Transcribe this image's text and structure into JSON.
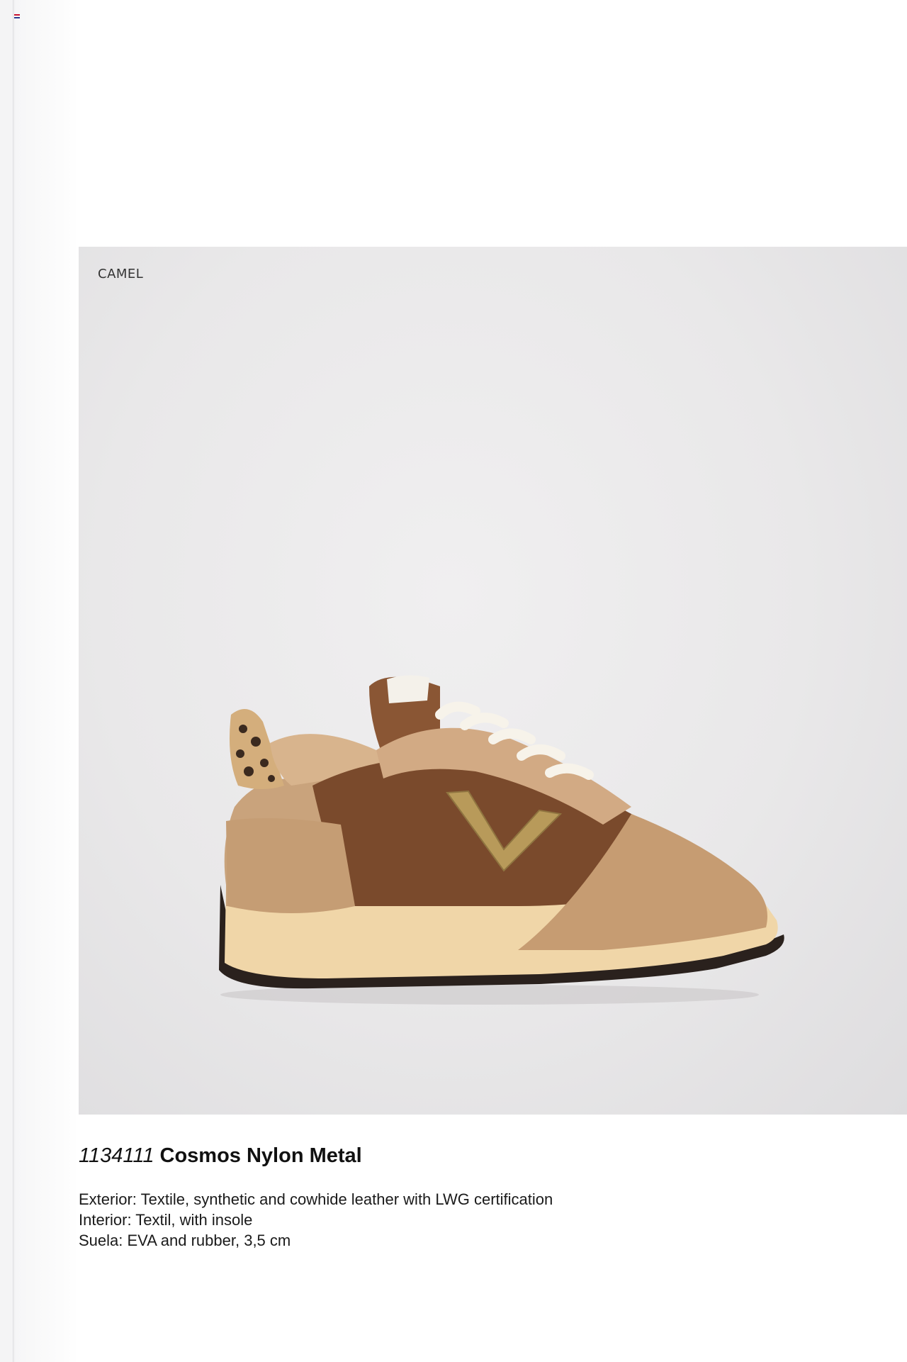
{
  "colors": {
    "flag_top": "#c8102e",
    "flag_mid": "#ffffff",
    "flag_bottom": "#2b3a8f",
    "shoe_tan": "#c8a07a",
    "shoe_brown": "#7a4a2c",
    "shoe_gold": "#b89a5a",
    "sole": "#f0d6a8"
  },
  "photo": {
    "color_label": "CAMEL",
    "image_alt": "Cosmos Nylon Metal sneaker in camel"
  },
  "product": {
    "code": "1134111",
    "name": "Cosmos Nylon Metal"
  },
  "specs": {
    "exterior": "Exterior: Textile, synthetic and cowhide leather with LWG certification",
    "interior": "Interior: Textil, with insole",
    "sole": "Suela: EVA and rubber, 3,5 cm"
  }
}
